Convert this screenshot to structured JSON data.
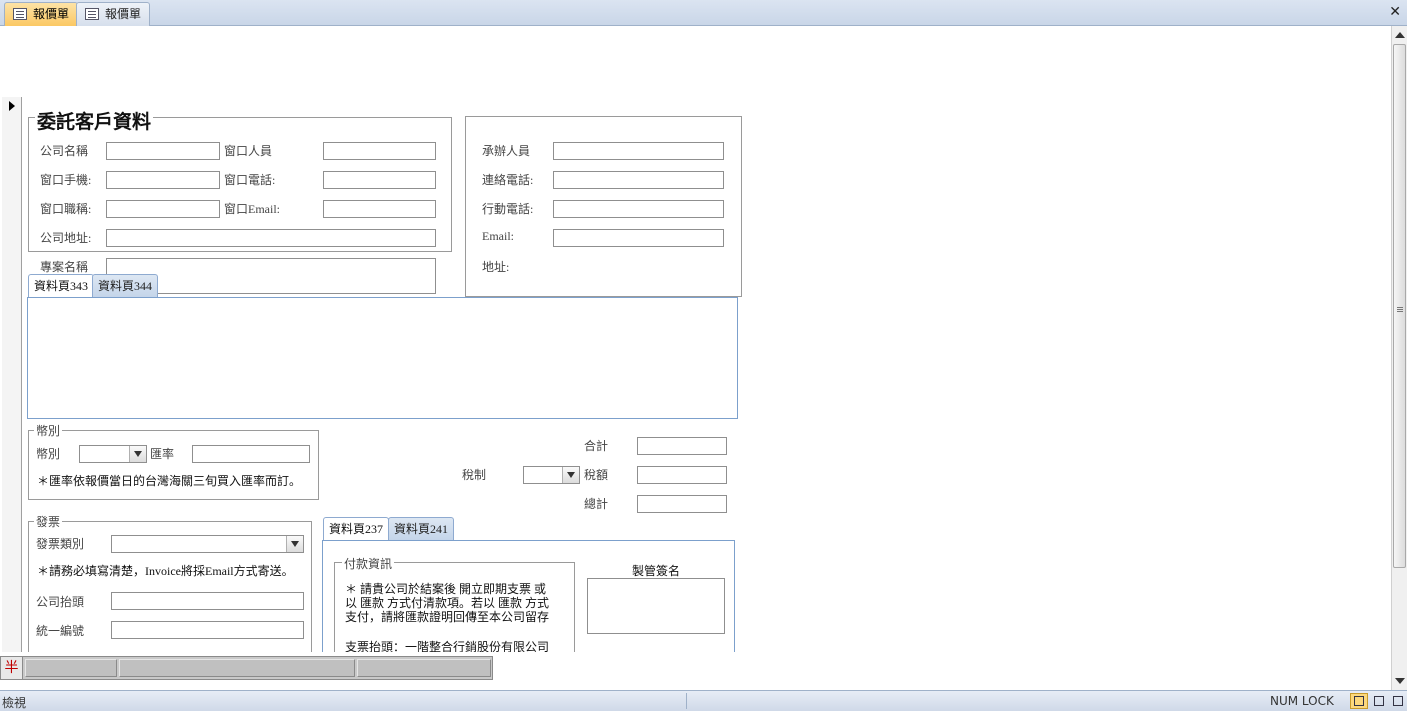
{
  "document_tabs": [
    {
      "label": "報價單",
      "active": true
    },
    {
      "label": "報價單",
      "active": false
    }
  ],
  "client_section": {
    "title": "委託客戶資料",
    "labels": {
      "company_name": "公司名稱",
      "contact_person": "窗口人員",
      "contact_mobile": "窗口手機:",
      "contact_phone": "窗口電話:",
      "contact_title": "窗口職稱:",
      "contact_email": "窗口Email:",
      "company_address": "公司地址:",
      "project_name": "專案名稱"
    }
  },
  "handler_section": {
    "labels": {
      "handler": "承辦人員",
      "contact_phone": "連絡電話:",
      "mobile": "行動電話:",
      "email": "Email:",
      "address": "地址:"
    }
  },
  "upper_tabs": [
    "資料頁343",
    "資料頁344"
  ],
  "currency_section": {
    "title": "幣別",
    "currency_label": "幣別",
    "rate_label": "匯率",
    "note": "＊匯率依報價當日的台灣海關三旬買入匯率而訂。"
  },
  "totals": {
    "subtotal_label": "合計",
    "tax_system_label": "稅制",
    "tax_label": "稅額",
    "total_label": "總計"
  },
  "invoice_section": {
    "title": "發票",
    "type_label": "發票類別",
    "note": "＊請務必填寫清楚，Invoice將採Email方式寄送。",
    "header_label": "公司抬頭",
    "tax_id_label": "統一編號"
  },
  "lower_tabs": [
    "資料頁237",
    "資料頁241"
  ],
  "payment_section": {
    "title": "付款資訊",
    "lines": [
      "＊ 請貴公司於結案後 開立即期支票 或",
      "以 匯款 方式付清款項。若以 匯款 方式",
      "支付，請將匯款證明回傳至本公司留存",
      "",
      "支票抬頭：一階整合行銷股份有限公司"
    ]
  },
  "signature_label": "製管簽名",
  "navbar": {
    "ime": "半"
  },
  "statusbar": {
    "view_mode": "檢視",
    "num_lock": "NUM LOCK"
  },
  "icons": [
    "form-icon",
    "close-icon",
    "record-selector-arrow-icon",
    "dropdown-arrow-icon",
    "form-view-icon",
    "layout-view-icon",
    "design-view-icon"
  ]
}
